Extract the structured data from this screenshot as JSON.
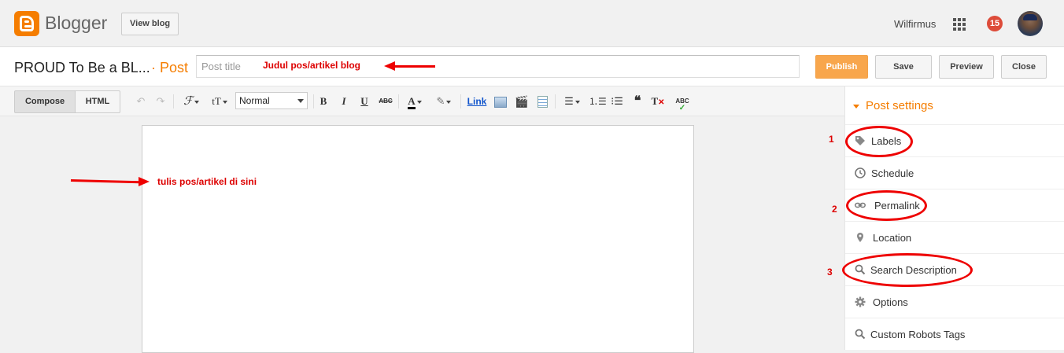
{
  "header": {
    "brand": "Blogger",
    "view_blog": "View blog",
    "username": "Wilfirmus",
    "notification_count": "15"
  },
  "titlebar": {
    "blog_name": "PROUD To Be a BL...",
    "separator": "·",
    "post_label": "Post",
    "title_placeholder": "Post title",
    "buttons": {
      "publish": "Publish",
      "save": "Save",
      "preview": "Preview",
      "close": "Close"
    }
  },
  "toolbar": {
    "compose": "Compose",
    "html": "HTML",
    "font_size_value": "Normal",
    "link": "Link"
  },
  "sidebar": {
    "heading": "Post settings",
    "items": [
      {
        "label": "Labels",
        "icon": "tag-icon"
      },
      {
        "label": "Schedule",
        "icon": "clock-icon"
      },
      {
        "label": "Permalink",
        "icon": "link-icon"
      },
      {
        "label": "Location",
        "icon": "location-pin-icon"
      },
      {
        "label": "Search Description",
        "icon": "search-icon"
      },
      {
        "label": "Options",
        "icon": "gear-icon"
      },
      {
        "label": "Custom Robots Tags",
        "icon": "search-icon"
      }
    ]
  },
  "annotations": {
    "title_note": "Judul pos/artikel blog",
    "body_note": "tulis pos/artikel di sini",
    "num1": "1",
    "num2": "2",
    "num3": "3"
  },
  "colors": {
    "accent": "#f57d00",
    "annotation": "#e00000",
    "publish": "#f8a64c"
  }
}
